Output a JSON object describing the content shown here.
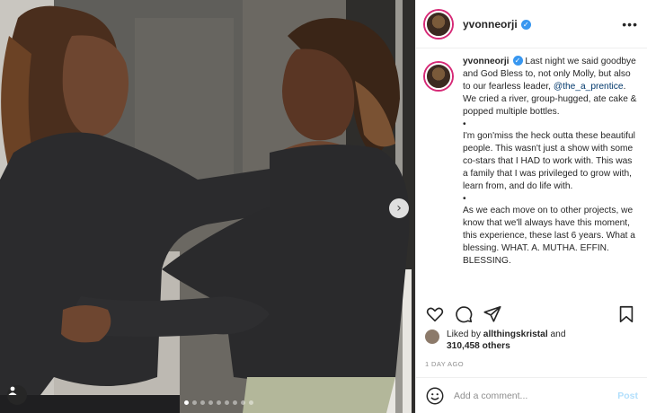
{
  "post": {
    "username": "yvonneorji",
    "verified_mark": "✓",
    "more_options": "•••",
    "caption_handle": "yvonneorji",
    "caption_p1_before": " Last night we said goodbye and God Bless to, not only Molly, but also to our fearless leader, ",
    "caption_mention": "@the_a_prentice",
    "caption_p1_after": ". We cried a river, group-hugged, ate cake & popped multiple bottles.",
    "bullet": "•",
    "caption_p2": "I'm gon'miss the heck outta these beautiful people. This wasn't just a show with some co-stars that I HAD to work with. This was a family that I was privileged to grow with, learn from, and do life with.",
    "caption_p3": "As we each move on to other projects, we know that we'll always have this moment, this experience, these last 6 years. What a blessing. WHAT. A. MUTHA. EFFIN. BLESSING.",
    "liked_by_prefix": "Liked by ",
    "liked_by_user": "allthingskristal",
    "liked_by_and": " and",
    "likes_count": "310,458 others",
    "time_ago": "1 DAY AGO",
    "comment_placeholder": "Add a comment...",
    "post_label": "Post",
    "next_arrow": "›"
  },
  "icons": {
    "heart": "heart-icon",
    "comment": "comment-icon",
    "share": "share-icon",
    "save": "bookmark-icon",
    "emoji": "emoji-icon",
    "user_tag": "user-tag-icon"
  },
  "carousel": {
    "slides": 9,
    "active": 0
  },
  "colors": {
    "verified": "#3897f0",
    "link": "#00376b",
    "post_button_disabled": "#b2dffc",
    "story_ring": "#d62976"
  }
}
